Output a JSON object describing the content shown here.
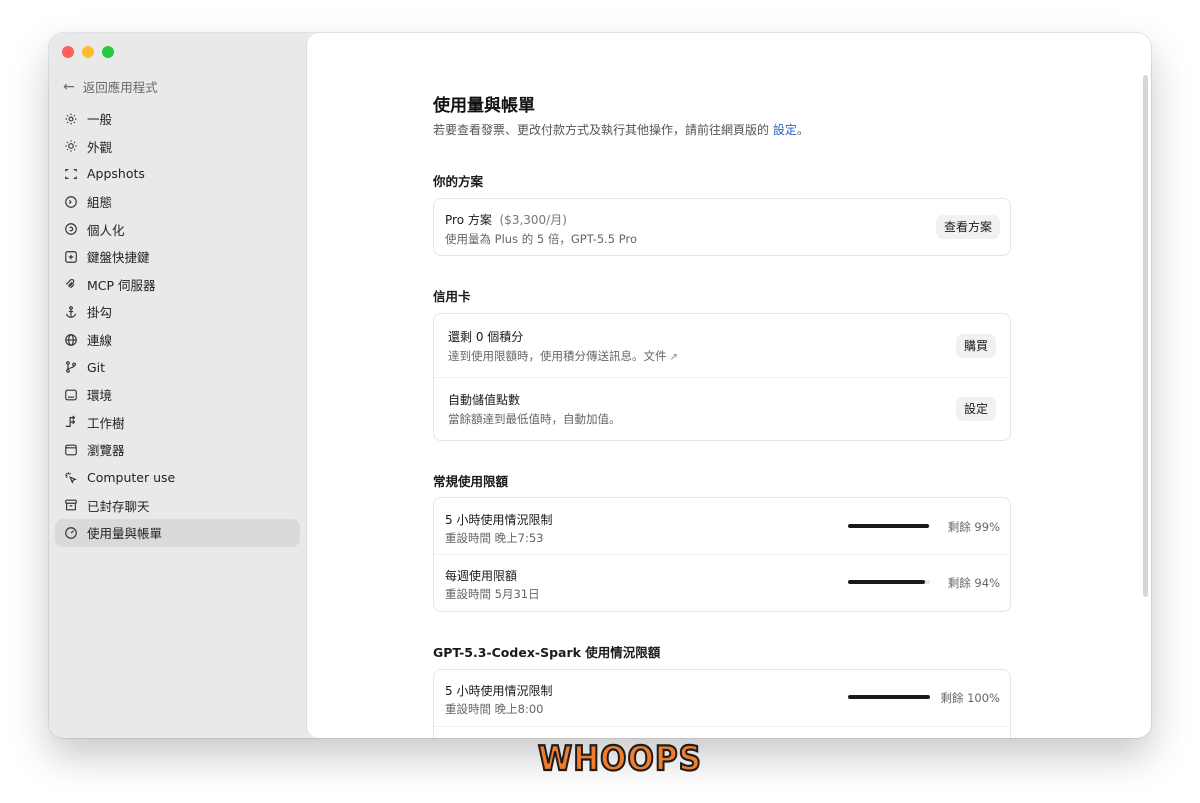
{
  "sidebar": {
    "back_label": "返回應用程式",
    "items": [
      {
        "label": "一般",
        "icon": "gear-icon"
      },
      {
        "label": "外觀",
        "icon": "sun-icon"
      },
      {
        "label": "Appshots",
        "icon": "screenshot-icon"
      },
      {
        "label": "組態",
        "icon": "config-icon"
      },
      {
        "label": "個人化",
        "icon": "personalize-icon"
      },
      {
        "label": "鍵盤快捷鍵",
        "icon": "keyboard-icon"
      },
      {
        "label": "MCP 伺服器",
        "icon": "mcp-icon"
      },
      {
        "label": "掛勾",
        "icon": "hook-icon"
      },
      {
        "label": "連線",
        "icon": "globe-icon"
      },
      {
        "label": "Git",
        "icon": "git-branch-icon"
      },
      {
        "label": "環境",
        "icon": "environment-icon"
      },
      {
        "label": "工作樹",
        "icon": "worktree-icon"
      },
      {
        "label": "瀏覽器",
        "icon": "browser-icon"
      },
      {
        "label": "Computer use",
        "icon": "computer-use-icon"
      },
      {
        "label": "已封存聊天",
        "icon": "archive-icon"
      },
      {
        "label": "使用量與帳單",
        "icon": "gauge-icon",
        "active": true
      }
    ]
  },
  "main": {
    "title": "使用量與帳單",
    "subtitle": "若要查看發票、更改付款方式及執行其他操作，請前往網頁版的",
    "subtitle_link": "設定",
    "subtitle_end": "。",
    "plan": {
      "section": "你的方案",
      "name": "Pro 方案",
      "price": "($3,300/月)",
      "desc": "使用量為 Plus 的 5 倍，GPT-5.5 Pro",
      "button": "查看方案"
    },
    "credits": {
      "section": "信用卡",
      "remaining_title": "還剩 0 個積分",
      "remaining_desc": "達到使用限額時，使用積分傳送訊息。文件",
      "buy_button": "購買",
      "auto_title": "自動儲值點數",
      "auto_desc": "當餘額達到最低值時，自動加值。",
      "settings_button": "設定"
    },
    "limits": {
      "section": "常規使用限額",
      "rows": [
        {
          "title": "5 小時使用情況限制",
          "reset": "重設時間 晚上7:53",
          "remaining_text": "剩餘 99%",
          "remaining": 99
        },
        {
          "title": "每週使用限額",
          "reset": "重設時間 5月31日",
          "remaining_text": "剩餘 94%",
          "remaining": 94
        }
      ]
    },
    "spark": {
      "section": "GPT-5.3-Codex-Spark 使用情況限額",
      "rows": [
        {
          "title": "5 小時使用情況限制",
          "reset": "重設時間 晚上8:00",
          "remaining_text": "剩餘 100%",
          "remaining": 100
        }
      ]
    }
  },
  "watermark": "WHOOPS"
}
